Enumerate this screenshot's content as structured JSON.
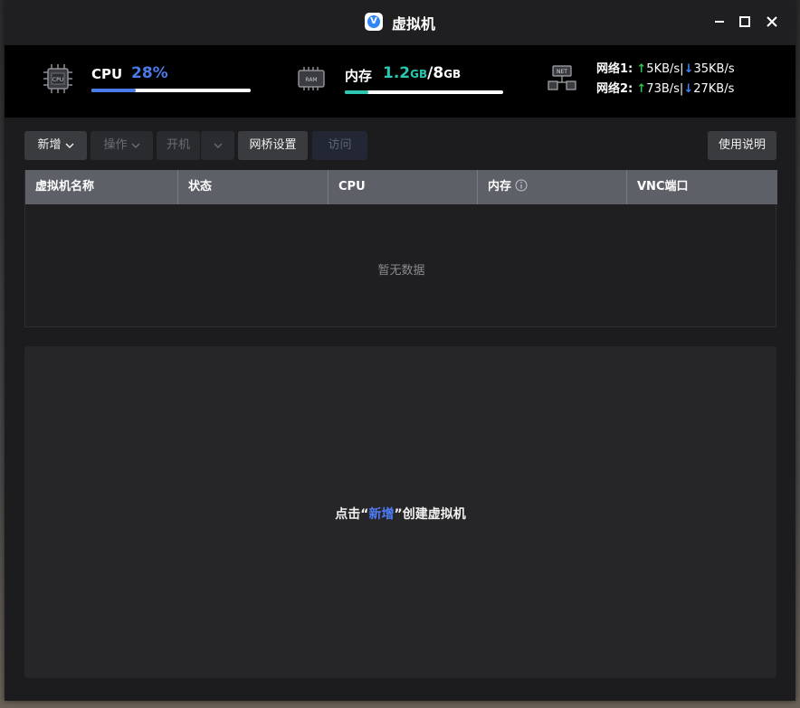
{
  "window": {
    "title": "虚拟机",
    "app_icon_letter": "V"
  },
  "monitor": {
    "cpu": {
      "label": "CPU",
      "value": "28%",
      "progress": 0.28,
      "color": "#4b7be8"
    },
    "memory": {
      "label": "内存",
      "used": "1.2",
      "used_unit": "GB",
      "slash": "/",
      "total": "8",
      "total_unit": "GB",
      "progress": 0.15,
      "color": "#2bc7b0"
    },
    "net": [
      {
        "label": "网络1:",
        "up": "5KB/s",
        "down": "35KB/s"
      },
      {
        "label": "网络2:",
        "up": "73B/s",
        "down": "27KB/s"
      }
    ],
    "chip_labels": {
      "cpu": "CPU",
      "ram": "RAM",
      "net": "NET"
    }
  },
  "toolbar": {
    "new_label": "新增",
    "operate_label": "操作",
    "power_label": "开机",
    "bridge_label": "网桥设置",
    "access_label": "访问",
    "help_label": "使用说明"
  },
  "table": {
    "columns": [
      "虚拟机名称",
      "状态",
      "CPU",
      "内存",
      "VNC端口"
    ],
    "empty_text": "暂无数据"
  },
  "panel": {
    "hint_prefix": "点击",
    "hint_open_quote": "“",
    "hint_link": "新增",
    "hint_close_quote": "”",
    "hint_suffix": "创建虚拟机"
  },
  "colors": {
    "up_arrow": "#2fc14c",
    "down_arrow": "#3b82f6",
    "link": "#4f7cf4"
  }
}
